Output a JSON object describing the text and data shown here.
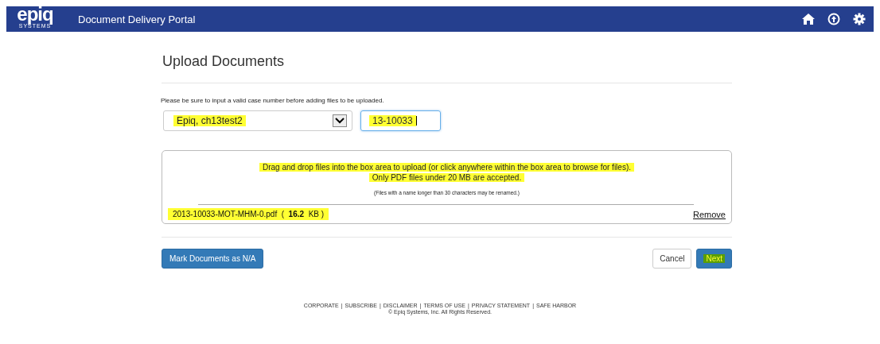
{
  "header": {
    "logo": "epiq",
    "logo_sub": "SYSTEMS",
    "title": "Document Delivery Portal"
  },
  "page_title": "Upload Documents",
  "instruction": "Please be sure to input a valid case number before adding files to be uploaded.",
  "case_select": {
    "value": "Epiq, ch13test2",
    "highlighted": true
  },
  "case_number": {
    "value": "13-10033",
    "highlighted": true
  },
  "dropzone": {
    "lines": [
      {
        "text": "Drag and drop files into the box area to upload (or click anywhere within the box area to browse for files).",
        "highlighted": true
      },
      {
        "text": "Only PDF files under 20 MB are accepted.",
        "highlighted": true
      }
    ],
    "note": "(Files with a name longer than 30 characters may be renamed.)"
  },
  "files": [
    {
      "name": "2013-10033-MOT-MHM-0.pdf",
      "open": "(",
      "size": "16.2",
      "unit": "KB",
      "close": ")",
      "highlighted": true,
      "action": "Remove"
    }
  ],
  "buttons": [
    {
      "label": "Mark Documents as N/A",
      "kind": "primary",
      "highlighted": false
    },
    {
      "label": "Cancel",
      "kind": "default",
      "highlighted": false
    },
    {
      "label": "Next",
      "kind": "primary",
      "highlighted": true
    }
  ],
  "footer": {
    "links": [
      "CORPORATE",
      "SUBSCRIBE",
      "DISCLAIMER",
      "TERMS OF USE",
      "PRIVACY STATEMENT",
      "SAFE HARBOR"
    ],
    "separator": "|",
    "copyright": "© Epiq Systems, Inc. All Rights Reserved."
  }
}
